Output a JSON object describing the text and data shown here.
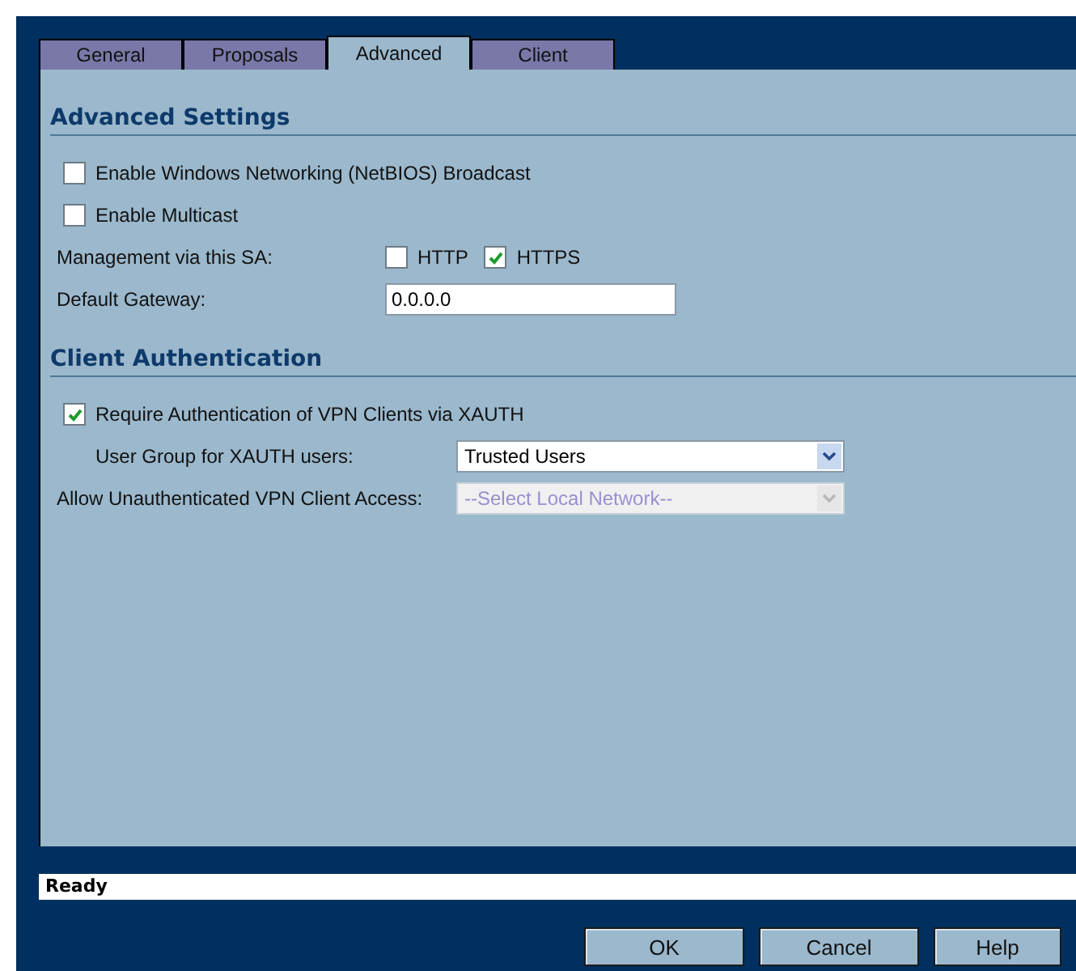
{
  "tabs": [
    {
      "label": "General",
      "selected": false
    },
    {
      "label": "Proposals",
      "selected": false
    },
    {
      "label": "Advanced",
      "selected": true
    },
    {
      "label": "Client",
      "selected": false
    }
  ],
  "sections": [
    {
      "title": "Advanced Settings",
      "rows": [
        {
          "kind": "checkbox",
          "label": "Enable Windows Networking (NetBIOS) Broadcast",
          "checked": false
        },
        {
          "kind": "checkbox",
          "label": "Enable Multicast",
          "checked": false
        },
        {
          "kind": "checks",
          "label": "Management via this SA:",
          "options": [
            {
              "label": "HTTP",
              "checked": false
            },
            {
              "label": "HTTPS",
              "checked": true
            }
          ]
        },
        {
          "kind": "text",
          "label": "Default Gateway:",
          "value": "0.0.0.0"
        }
      ]
    },
    {
      "title": "Client Authentication",
      "rows": [
        {
          "kind": "checkbox",
          "label": "Require Authentication of VPN Clients via XAUTH",
          "checked": true,
          "children": [
            {
              "kind": "select",
              "label": "User Group for XAUTH users:",
              "value": "Trusted Users",
              "disabled": false
            }
          ]
        },
        {
          "kind": "select",
          "label": "Allow Unauthenticated VPN Client Access:",
          "value": "--Select Local Network--",
          "disabled": true
        }
      ]
    }
  ],
  "status_bar": "Ready",
  "buttons": [
    "OK",
    "Cancel",
    "Help"
  ]
}
